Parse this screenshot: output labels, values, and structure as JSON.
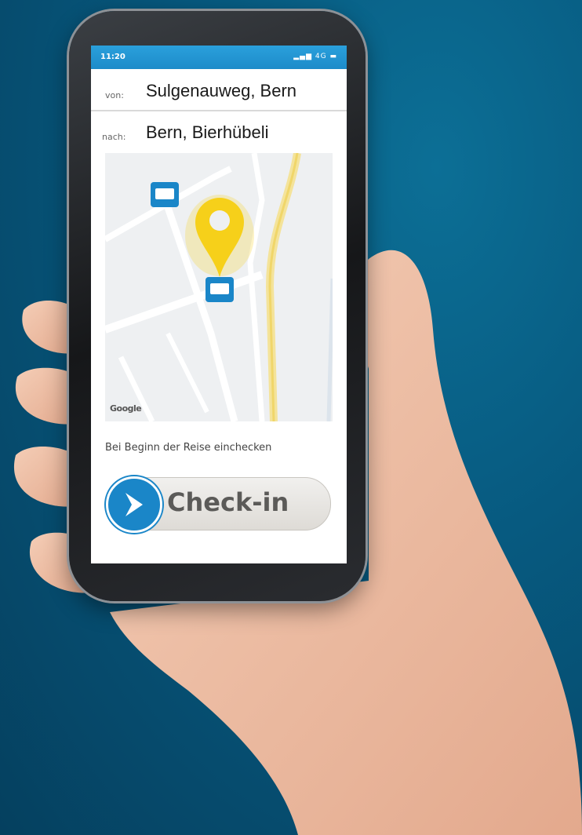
{
  "status": {
    "time": "11:20",
    "signal": "4G"
  },
  "from": {
    "label": "von:",
    "value": "Sulgenauweg, Bern"
  },
  "to": {
    "label": "nach:",
    "value": "Bern, Bierhübeli"
  },
  "map": {
    "attribution": "Google"
  },
  "hint": "Bei Beginn der Reise einchecken",
  "checkin": {
    "label": "Check-in"
  },
  "colors": {
    "accent": "#1a86c8",
    "pin": "#f6d01a",
    "status_bar": "#2aa0dc"
  }
}
